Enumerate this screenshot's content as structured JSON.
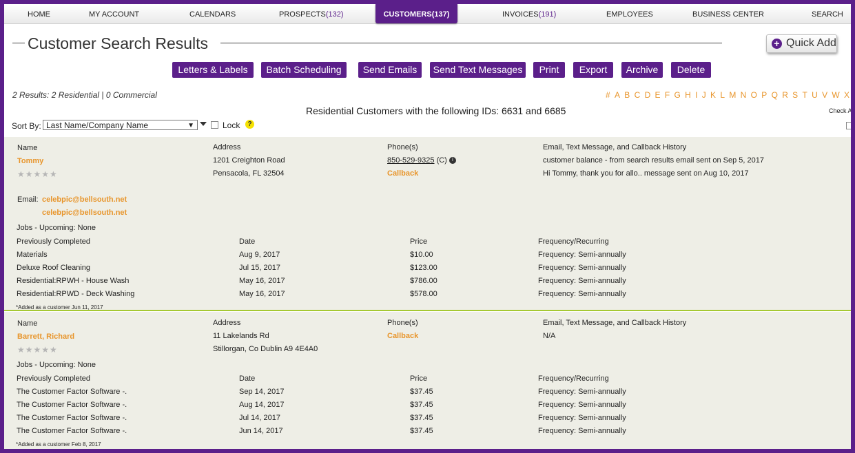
{
  "nav": {
    "home": "HOME",
    "my_account": "MY ACCOUNT",
    "calendars": "CALENDARS",
    "prospects": "PROSPECTS",
    "prospects_count": "(132)",
    "customers": "CUSTOMERS",
    "customers_count": "(137)",
    "invoices": "INVOICES",
    "invoices_count": "(191)",
    "employees": "EMPLOYEES",
    "business_center": "BUSINESS CENTER",
    "search": "SEARCH"
  },
  "page": {
    "title": "Customer Search Results",
    "quick_add": "Quick Add",
    "quick_add_icon": "plus-circle-icon"
  },
  "actions": {
    "letters": "Letters & Labels",
    "batch": "Batch Scheduling",
    "emails": "Send Emails",
    "texts": "Send Text Messages",
    "print": "Print",
    "export": "Export",
    "archive": "Archive",
    "delete": "Delete"
  },
  "summary": "2 Results: 2 Residential | 0 Commercial",
  "alpha": [
    "#",
    "A",
    "B",
    "C",
    "D",
    "E",
    "F",
    "G",
    "H",
    "I",
    "J",
    "K",
    "L",
    "M",
    "N",
    "O",
    "P",
    "Q",
    "R",
    "S",
    "T",
    "U",
    "V",
    "W",
    "X"
  ],
  "check_all": "Check All",
  "results_heading": "Residential Customers with the following IDs: 6631 and 6685",
  "sort": {
    "label": "Sort By:",
    "value": "Last Name/Company Name",
    "lock": "Lock",
    "help": "?"
  },
  "headers": {
    "name": "Name",
    "address": "Address",
    "phones": "Phone(s)",
    "history": "Email, Text Message, and Callback History",
    "jobs_upcoming": "Jobs - Upcoming:",
    "prev_completed": "Previously Completed",
    "date": "Date",
    "price": "Price",
    "frequency": "Frequency/Recurring",
    "email": "Email:"
  },
  "customers": [
    {
      "name": "Tommy",
      "stars": "★★★★★",
      "address1": "1201 Creighton Road",
      "address2": "Pensacola, FL 32504",
      "phone": "850-529-9325",
      "phone_type": "(C)",
      "callback": "Callback",
      "history": [
        "customer balance - from search results email sent on Sep 5, 2017",
        "Hi Tommy, thank you for allo.. message sent on Aug 10, 2017"
      ],
      "emails": [
        "celebpic@bellsouth.net",
        "celebpic@bellsouth.net"
      ],
      "upcoming": "None",
      "jobs": [
        {
          "name": "Materials",
          "date": "Aug 9, 2017",
          "price": "$10.00",
          "freq": "Frequency: Semi-annually"
        },
        {
          "name": "Deluxe Roof Cleaning",
          "date": "Jul 15, 2017",
          "price": "$123.00",
          "freq": "Frequency: Semi-annually"
        },
        {
          "name": "Residential:RPWH - House Wash",
          "date": "May 16, 2017",
          "price": "$786.00",
          "freq": "Frequency: Semi-annually"
        },
        {
          "name": "Residential:RPWD - Deck Washing",
          "date": "May 16, 2017",
          "price": "$578.00",
          "freq": "Frequency: Semi-annually"
        }
      ],
      "added": "*Added as a customer Jun 11, 2017"
    },
    {
      "name": "Barrett, Richard",
      "stars": "★★★★★",
      "address1": "11 Lakelands Rd",
      "address2": "Stillorgan, Co Dublin A9 4E4A0",
      "callback": "Callback",
      "history": [
        "N/A"
      ],
      "upcoming": "None",
      "jobs": [
        {
          "name": "The Customer Factor Software -.",
          "date": "Sep 14, 2017",
          "price": "$37.45",
          "freq": "Frequency: Semi-annually"
        },
        {
          "name": "The Customer Factor Software -.",
          "date": "Aug 14, 2017",
          "price": "$37.45",
          "freq": "Frequency: Semi-annually"
        },
        {
          "name": "The Customer Factor Software -.",
          "date": "Jul 14, 2017",
          "price": "$37.45",
          "freq": "Frequency: Semi-annually"
        },
        {
          "name": "The Customer Factor Software -.",
          "date": "Jun 14, 2017",
          "price": "$37.45",
          "freq": "Frequency: Semi-annually"
        }
      ],
      "added": "*Added as a customer Feb 8, 2017"
    }
  ],
  "colors": {
    "brand": "#5b1f8a",
    "link": "#e8952b",
    "panel": "#eeeee6",
    "divider": "#a5c832"
  }
}
